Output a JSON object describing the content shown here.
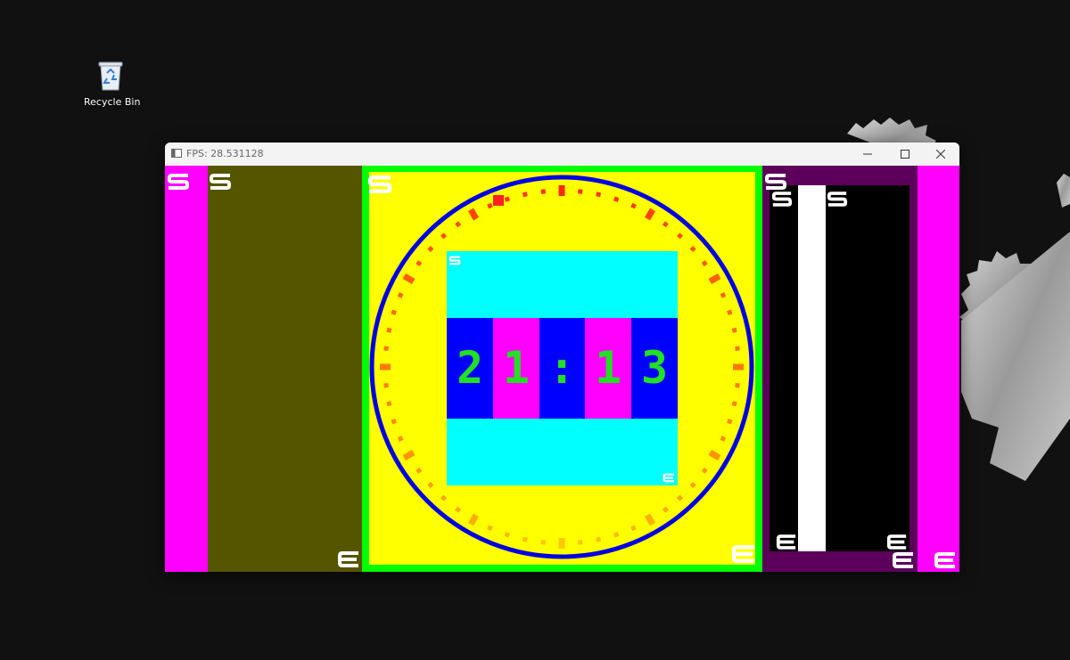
{
  "desktop": {
    "recycle_bin_label": "Recycle Bin"
  },
  "window": {
    "title": "FPS: 28.531128",
    "minimize_icon": "minimize-icon",
    "maximize_icon": "maximize-icon",
    "close_icon": "close-icon"
  },
  "clock": {
    "hour_tens": "2",
    "hour_ones": "1",
    "separator": ":",
    "minute_tens": "1",
    "minute_ones": "3"
  },
  "colors": {
    "magenta": "#ff00ff",
    "olive": "#555500",
    "green": "#00ff00",
    "yellow": "#ffff00",
    "cyan": "#00ffff",
    "blue": "#0000ff",
    "purple": "#5c005c",
    "digit": "#22e022"
  }
}
